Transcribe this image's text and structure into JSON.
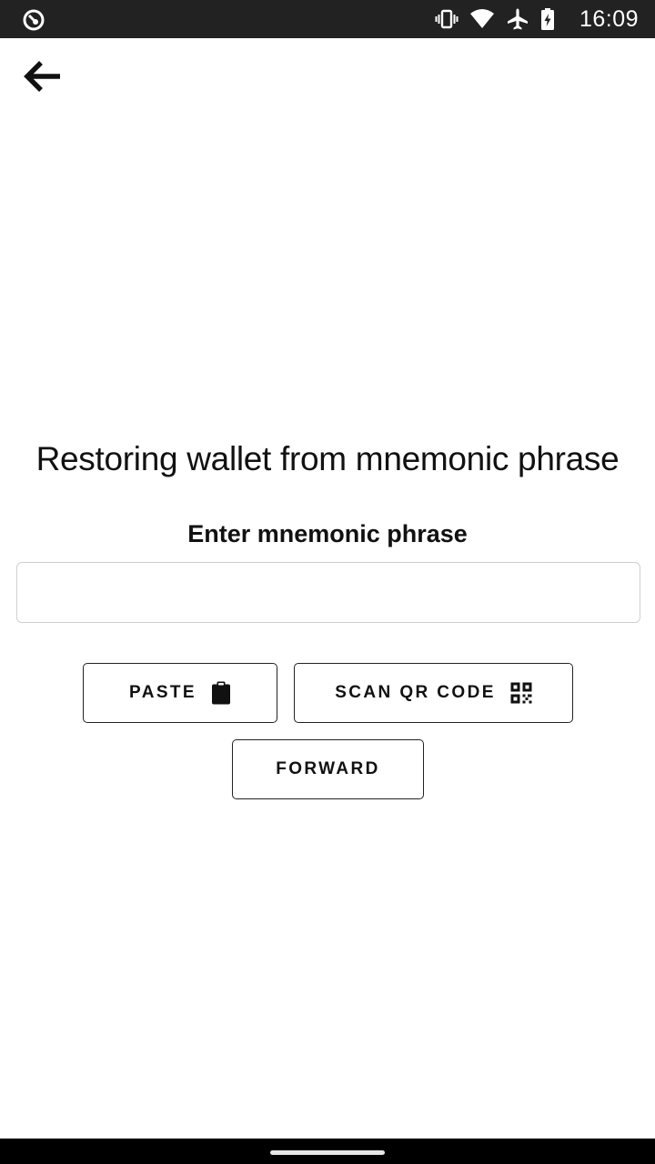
{
  "status_bar": {
    "time": "16:09",
    "icons": [
      "app-indicator-icon",
      "vibrate-icon",
      "wifi-icon",
      "airplane-mode-icon",
      "battery-charging-icon"
    ]
  },
  "header": {
    "back_icon": "arrow-left-icon"
  },
  "main": {
    "title": "Restoring wallet from mnemonic phrase",
    "input_label": "Enter mnemonic phrase",
    "input_value": "",
    "input_placeholder": "",
    "buttons": {
      "paste": {
        "label": "PASTE",
        "icon": "clipboard-icon"
      },
      "scan": {
        "label": "SCAN QR CODE",
        "icon": "qr-code-icon"
      },
      "forward": {
        "label": "FORWARD"
      }
    }
  },
  "colors": {
    "status_bar_bg": "#222222",
    "nav_bar_bg": "#000000",
    "text": "#111111",
    "border": "#222222",
    "input_border": "#cfcfcf"
  }
}
